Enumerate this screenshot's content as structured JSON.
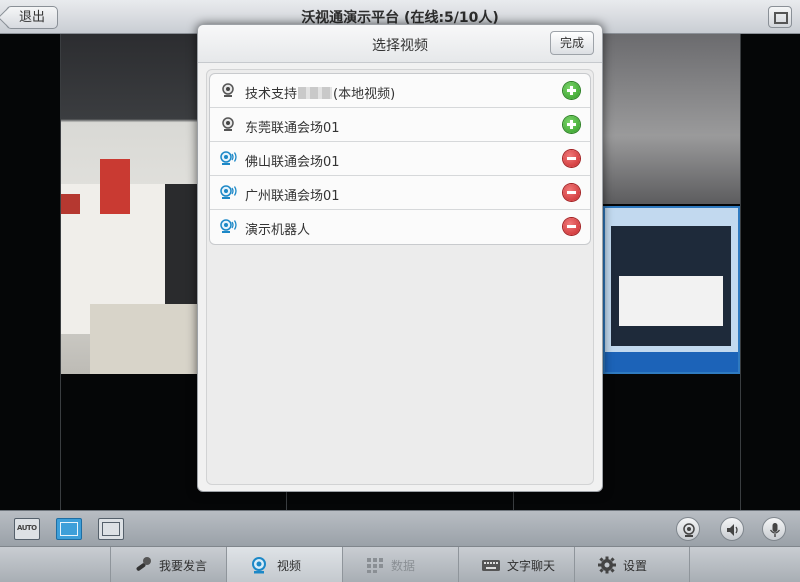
{
  "topbar": {
    "back_label": "退出",
    "title": "沃视通演示平台 (在线:5/10人)"
  },
  "modal": {
    "title": "选择视频",
    "done_label": "完成",
    "items": [
      {
        "label_prefix": "技术支持",
        "label_suffix": "(本地视频)",
        "icon": "webcam-icon",
        "action": "add"
      },
      {
        "label": "东莞联通会场01",
        "icon": "webcam-icon",
        "action": "add"
      },
      {
        "label": "佛山联通会场01",
        "icon": "broadcasting-webcam-icon",
        "action": "remove"
      },
      {
        "label": "广州联通会场01",
        "icon": "broadcasting-webcam-icon",
        "action": "remove"
      },
      {
        "label": "演示机器人",
        "icon": "broadcasting-webcam-icon",
        "action": "remove"
      }
    ]
  },
  "controls": {
    "layout_auto_label": "AUTO"
  },
  "tabs": [
    {
      "label": "我要发言",
      "icon": "microphone-icon",
      "state": "normal"
    },
    {
      "label": "视频",
      "icon": "webcam-icon",
      "state": "active"
    },
    {
      "label": "数据",
      "icon": "grid-icon",
      "state": "disabled"
    },
    {
      "label": "文字聊天",
      "icon": "keyboard-icon",
      "state": "normal"
    },
    {
      "label": "设置",
      "icon": "gear-icon",
      "state": "normal"
    }
  ],
  "colors": {
    "accent": "#3e9fd9",
    "add": "#2f9a24",
    "remove": "#c9272a"
  }
}
